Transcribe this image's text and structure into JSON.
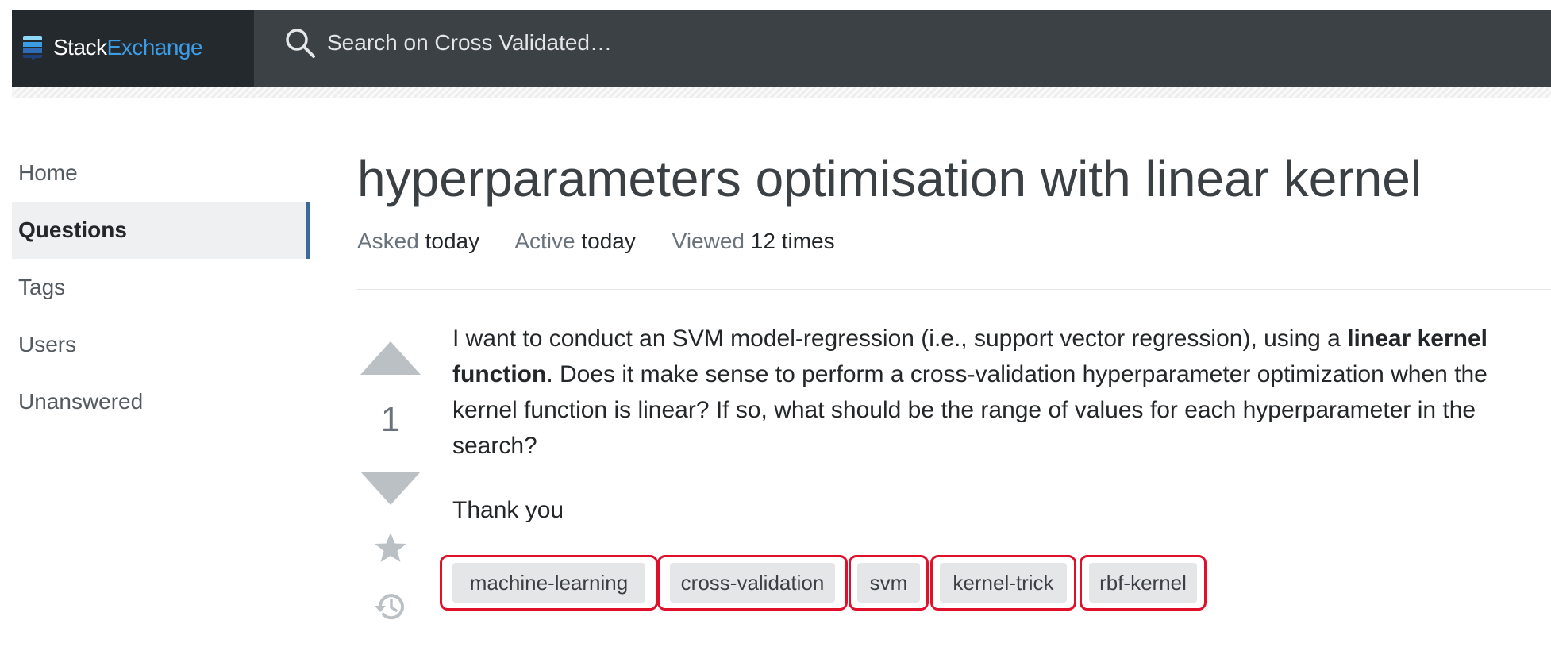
{
  "header": {
    "logo_stack": "Stack",
    "logo_exchange": "Exchange",
    "search_placeholder": "Search on Cross Validated…"
  },
  "sidebar": {
    "items": [
      {
        "label": "Home"
      },
      {
        "label": "Questions",
        "active": true
      },
      {
        "label": "Tags"
      },
      {
        "label": "Users"
      },
      {
        "label": "Unanswered"
      }
    ]
  },
  "question": {
    "title": "hyperparameters optimisation with linear kernel",
    "meta": {
      "asked_label": "Asked",
      "asked_value": "today",
      "active_label": "Active",
      "active_value": "today",
      "viewed_label": "Viewed",
      "viewed_value": "12 times"
    },
    "votes": "1",
    "body": {
      "p1_before": "I want to conduct an SVM model-regression (i.e., support vector regression), using a ",
      "p1_bold": "linear kernel function",
      "p1_after": ". Does it make sense to perform a cross-validation hyperparameter optimization when the kernel function is linear? If so, what should be the range of values for each hyperparameter in the search?",
      "p2": "Thank you"
    },
    "tags": [
      "machine-learning",
      "cross-validation",
      "svm",
      "kernel-trick",
      "rbf-kernel"
    ]
  },
  "icons": {
    "logo": "stackexchange-logo-icon",
    "search": "search-icon",
    "vote_up": "arrow-up-icon",
    "vote_down": "arrow-down-icon",
    "bookmark": "star-icon",
    "history": "history-icon"
  },
  "colors": {
    "topbar": "#3c4146",
    "brand_blue": "#3d9ce6",
    "active_nav_border": "#3a6a98",
    "tag_bg": "#e4e6e8",
    "highlight_outline": "#e0102a"
  }
}
